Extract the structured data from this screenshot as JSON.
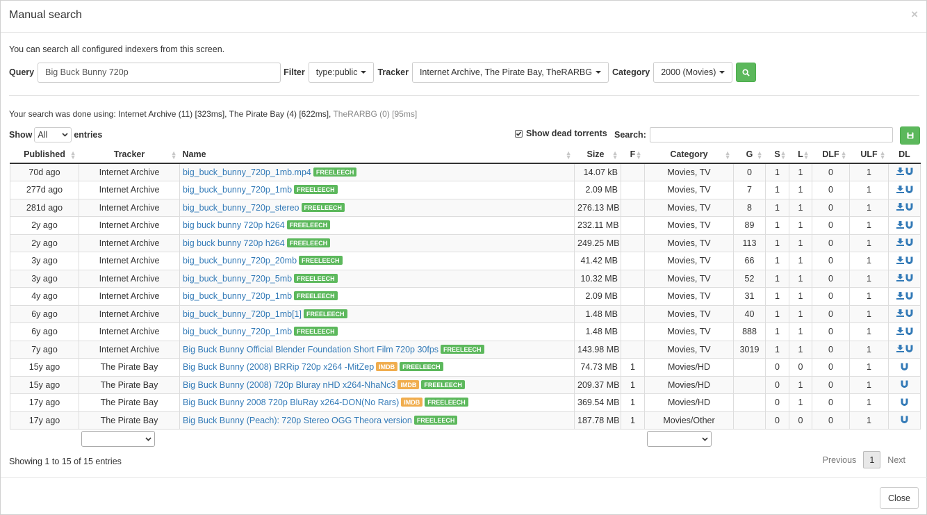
{
  "modal": {
    "title": "Manual search",
    "close_glyph": "×"
  },
  "intro": "You can search all configured indexers from this screen.",
  "search": {
    "query_label": "Query",
    "query_value": "Big Buck Bunny 720p",
    "filter_label": "Filter",
    "filter_value": "type:public",
    "tracker_label": "Tracker",
    "tracker_value": "Internet Archive, The Pirate Bay, TheRARBG",
    "category_label": "Category",
    "category_value": "2000 (Movies)",
    "search_icon": "search-icon"
  },
  "search_info": {
    "prefix": "Your search was done using: ",
    "active": "Internet Archive (11) [323ms], The Pirate Bay (4) [622ms],",
    "inactive": " TheRARBG (0) [95ms]"
  },
  "table_controls": {
    "show_label": "Show",
    "show_value": "All",
    "entries_label": "entries",
    "dead_label": "Show dead torrents",
    "search_label": "Search:",
    "save_icon": "save-icon"
  },
  "columns": [
    "Published",
    "Tracker",
    "Name",
    "Size",
    "F",
    "Category",
    "G",
    "S",
    "L",
    "DLF",
    "ULF",
    "DL"
  ],
  "rows": [
    {
      "published": "70d ago",
      "tracker": "Internet Archive",
      "name": "big_buck_bunny_720p_1mb.mp4",
      "imdb": "",
      "badge": "FREELEECH",
      "size": "14.07 kB",
      "f": "",
      "category": "Movies, TV",
      "g": "0",
      "s": "1",
      "l": "1",
      "dlf": "0",
      "ulf": "1",
      "dl": "both"
    },
    {
      "published": "277d ago",
      "tracker": "Internet Archive",
      "name": "big_buck_bunny_720p_1mb",
      "imdb": "",
      "badge": "FREELEECH",
      "size": "2.09 MB",
      "f": "",
      "category": "Movies, TV",
      "g": "7",
      "s": "1",
      "l": "1",
      "dlf": "0",
      "ulf": "1",
      "dl": "both"
    },
    {
      "published": "281d ago",
      "tracker": "Internet Archive",
      "name": "big_buck_bunny_720p_stereo",
      "imdb": "",
      "badge": "FREELEECH",
      "size": "276.13 MB",
      "f": "",
      "category": "Movies, TV",
      "g": "8",
      "s": "1",
      "l": "1",
      "dlf": "0",
      "ulf": "1",
      "dl": "both"
    },
    {
      "published": "2y ago",
      "tracker": "Internet Archive",
      "name": "big buck bunny 720p h264",
      "imdb": "",
      "badge": "FREELEECH",
      "size": "232.11 MB",
      "f": "",
      "category": "Movies, TV",
      "g": "89",
      "s": "1",
      "l": "1",
      "dlf": "0",
      "ulf": "1",
      "dl": "both"
    },
    {
      "published": "2y ago",
      "tracker": "Internet Archive",
      "name": "big buck bunny 720p h264",
      "imdb": "",
      "badge": "FREELEECH",
      "size": "249.25 MB",
      "f": "",
      "category": "Movies, TV",
      "g": "113",
      "s": "1",
      "l": "1",
      "dlf": "0",
      "ulf": "1",
      "dl": "both"
    },
    {
      "published": "3y ago",
      "tracker": "Internet Archive",
      "name": "big_buck_bunny_720p_20mb",
      "imdb": "",
      "badge": "FREELEECH",
      "size": "41.42 MB",
      "f": "",
      "category": "Movies, TV",
      "g": "66",
      "s": "1",
      "l": "1",
      "dlf": "0",
      "ulf": "1",
      "dl": "both"
    },
    {
      "published": "3y ago",
      "tracker": "Internet Archive",
      "name": "big_buck_bunny_720p_5mb",
      "imdb": "",
      "badge": "FREELEECH",
      "size": "10.32 MB",
      "f": "",
      "category": "Movies, TV",
      "g": "52",
      "s": "1",
      "l": "1",
      "dlf": "0",
      "ulf": "1",
      "dl": "both"
    },
    {
      "published": "4y ago",
      "tracker": "Internet Archive",
      "name": "big_buck_bunny_720p_1mb",
      "imdb": "",
      "badge": "FREELEECH",
      "size": "2.09 MB",
      "f": "",
      "category": "Movies, TV",
      "g": "31",
      "s": "1",
      "l": "1",
      "dlf": "0",
      "ulf": "1",
      "dl": "both"
    },
    {
      "published": "6y ago",
      "tracker": "Internet Archive",
      "name": "big_buck_bunny_720p_1mb[1]",
      "imdb": "",
      "badge": "FREELEECH",
      "size": "1.48 MB",
      "f": "",
      "category": "Movies, TV",
      "g": "40",
      "s": "1",
      "l": "1",
      "dlf": "0",
      "ulf": "1",
      "dl": "both"
    },
    {
      "published": "6y ago",
      "tracker": "Internet Archive",
      "name": "big_buck_bunny_720p_1mb",
      "imdb": "",
      "badge": "FREELEECH",
      "size": "1.48 MB",
      "f": "",
      "category": "Movies, TV",
      "g": "888",
      "s": "1",
      "l": "1",
      "dlf": "0",
      "ulf": "1",
      "dl": "both"
    },
    {
      "published": "7y ago",
      "tracker": "Internet Archive",
      "name": "Big Buck Bunny Official Blender Foundation Short Film 720p 30fps",
      "imdb": "",
      "badge": "FREELEECH",
      "size": "143.98 MB",
      "f": "",
      "category": "Movies, TV",
      "g": "3019",
      "s": "1",
      "l": "1",
      "dlf": "0",
      "ulf": "1",
      "dl": "both"
    },
    {
      "published": "15y ago",
      "tracker": "The Pirate Bay",
      "name": "Big Buck Bunny (2008) BRRip 720p x264 -MitZep",
      "imdb": "IMDB",
      "badge": "FREELEECH",
      "size": "74.73 MB",
      "f": "1",
      "category": "Movies/HD",
      "g": "",
      "s": "0",
      "l": "0",
      "dlf": "0",
      "ulf": "1",
      "dl": "magnet"
    },
    {
      "published": "15y ago",
      "tracker": "The Pirate Bay",
      "name": "Big Buck Bunny (2008) 720p Bluray nHD x264-NhaNc3",
      "imdb": "IMDB",
      "badge": "FREELEECH",
      "size": "209.37 MB",
      "f": "1",
      "category": "Movies/HD",
      "g": "",
      "s": "0",
      "l": "1",
      "dlf": "0",
      "ulf": "1",
      "dl": "magnet"
    },
    {
      "published": "17y ago",
      "tracker": "The Pirate Bay",
      "name": "Big Buck Bunny 2008 720p BluRay x264-DON(No Rars)",
      "imdb": "IMDB",
      "badge": "FREELEECH",
      "size": "369.54 MB",
      "f": "1",
      "category": "Movies/HD",
      "g": "",
      "s": "0",
      "l": "1",
      "dlf": "0",
      "ulf": "1",
      "dl": "magnet"
    },
    {
      "published": "17y ago",
      "tracker": "The Pirate Bay",
      "name": "Big Buck Bunny (Peach): 720p Stereo OGG Theora version",
      "imdb": "",
      "badge": "FREELEECH",
      "size": "187.78 MB",
      "f": "1",
      "category": "Movies/Other",
      "g": "",
      "s": "0",
      "l": "0",
      "dlf": "0",
      "ulf": "1",
      "dl": "magnet"
    }
  ],
  "footer": {
    "showing": "Showing 1 to 15 of 15 entries",
    "previous": "Previous",
    "page": "1",
    "next": "Next",
    "close": "Close"
  },
  "colors": {
    "accent_green": "#5cb85c",
    "link_blue": "#337ab7",
    "imdb_gold": "#f0ad4e"
  }
}
